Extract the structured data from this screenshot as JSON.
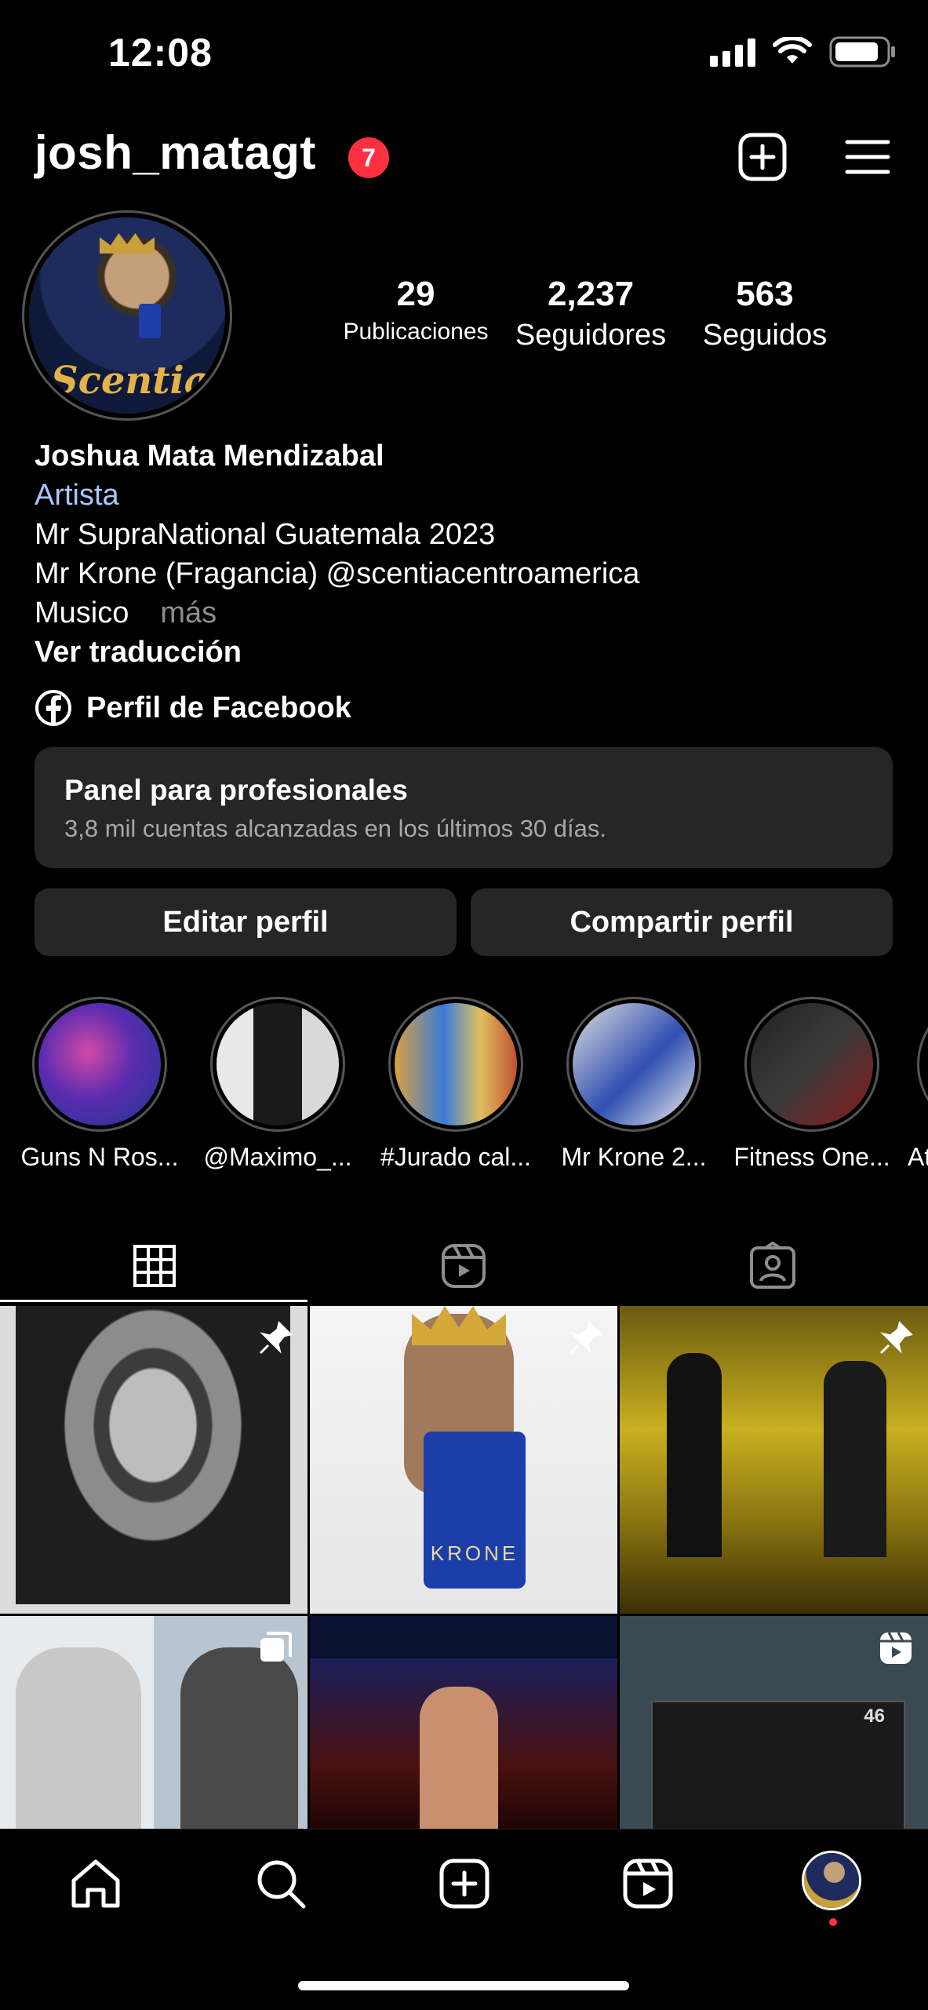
{
  "status_bar": {
    "time": "12:08"
  },
  "header": {
    "username": "josh_matagt",
    "notification_count": "7"
  },
  "stats": [
    {
      "value": "29",
      "label": "Publicaciones"
    },
    {
      "value": "2,237",
      "label": "Seguidores"
    },
    {
      "value": "563",
      "label": "Seguidos"
    }
  ],
  "avatar": {
    "brand_text": "Scentia"
  },
  "bio": {
    "name": "Joshua Mata Mendizabal",
    "category": "Artista",
    "line1": "Mr SupraNational Guatemala 2023",
    "line2": "Mr Krone (Fragancia) @scentiacentroamerica",
    "line3": "Musico",
    "more": "más",
    "translate": "Ver traducción"
  },
  "facebook_link": "Perfil de Facebook",
  "dashboard": {
    "title": "Panel para profesionales",
    "subtitle": "3,8 mil cuentas alcanzadas en los últimos 30 días."
  },
  "buttons": {
    "edit": "Editar perfil",
    "share": "Compartir perfil"
  },
  "highlights": [
    {
      "label": "Guns N Ros..."
    },
    {
      "label": "@Maximo_..."
    },
    {
      "label": "#Jurado cal..."
    },
    {
      "label": "Mr Krone 2..."
    },
    {
      "label": "Fitness One..."
    },
    {
      "label": "At"
    }
  ],
  "posts": [
    {
      "pinned": true,
      "type": "photo"
    },
    {
      "pinned": true,
      "type": "photo",
      "caption": "KRONE"
    },
    {
      "pinned": true,
      "type": "photo"
    },
    {
      "pinned": false,
      "type": "carousel"
    },
    {
      "pinned": false,
      "type": "photo"
    },
    {
      "pinned": false,
      "type": "reel",
      "overlay_text": "46"
    }
  ],
  "icons": [
    "new-post-icon",
    "menu-icon",
    "grid-icon",
    "reels-icon",
    "tagged-icon",
    "home-icon",
    "search-icon",
    "create-icon",
    "reels-nav-icon",
    "profile-avatar-icon"
  ],
  "colors": {
    "badge": "#ff3040",
    "link": "#a8c7fa",
    "surface": "#262626"
  }
}
